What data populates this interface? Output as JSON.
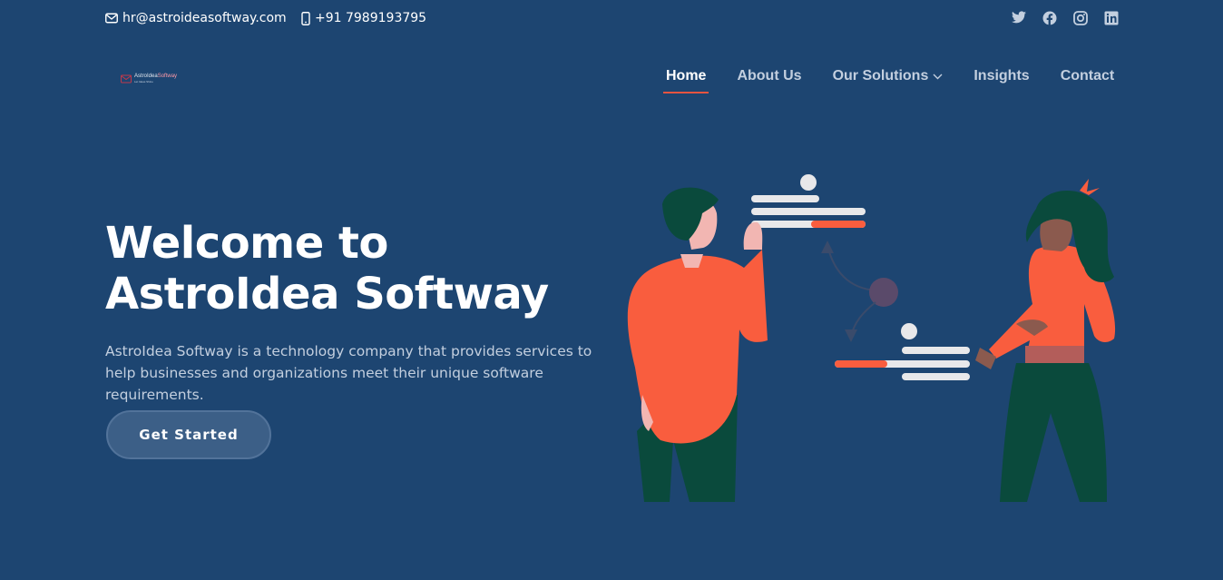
{
  "topbar": {
    "email": "hr@astroideasoftway.com",
    "phone": "+91 7989193795",
    "socials": [
      "twitter-icon",
      "facebook-icon",
      "instagram-icon",
      "linkedin-icon"
    ]
  },
  "logo": {
    "text_a": "AstroIdea",
    "text_b": "Softway",
    "tagline": "Let Ideas Shine"
  },
  "nav": {
    "items": [
      {
        "label": "Home",
        "active": true
      },
      {
        "label": "About Us"
      },
      {
        "label": "Our Solutions",
        "has_dropdown": true
      },
      {
        "label": "Insights"
      },
      {
        "label": "Contact"
      }
    ]
  },
  "hero": {
    "title_line1": "Welcome to",
    "title_line2": "AstroIdea Softway",
    "description": "AstroIdea Softway is a technology company that provides services to help businesses and organizations meet their unique software requirements.",
    "cta_label": "Get Started"
  },
  "colors": {
    "background": "#1d4571",
    "accent": "#e55440",
    "illustration_orange": "#f95d3e",
    "illustration_green": "#0a4a3c"
  }
}
